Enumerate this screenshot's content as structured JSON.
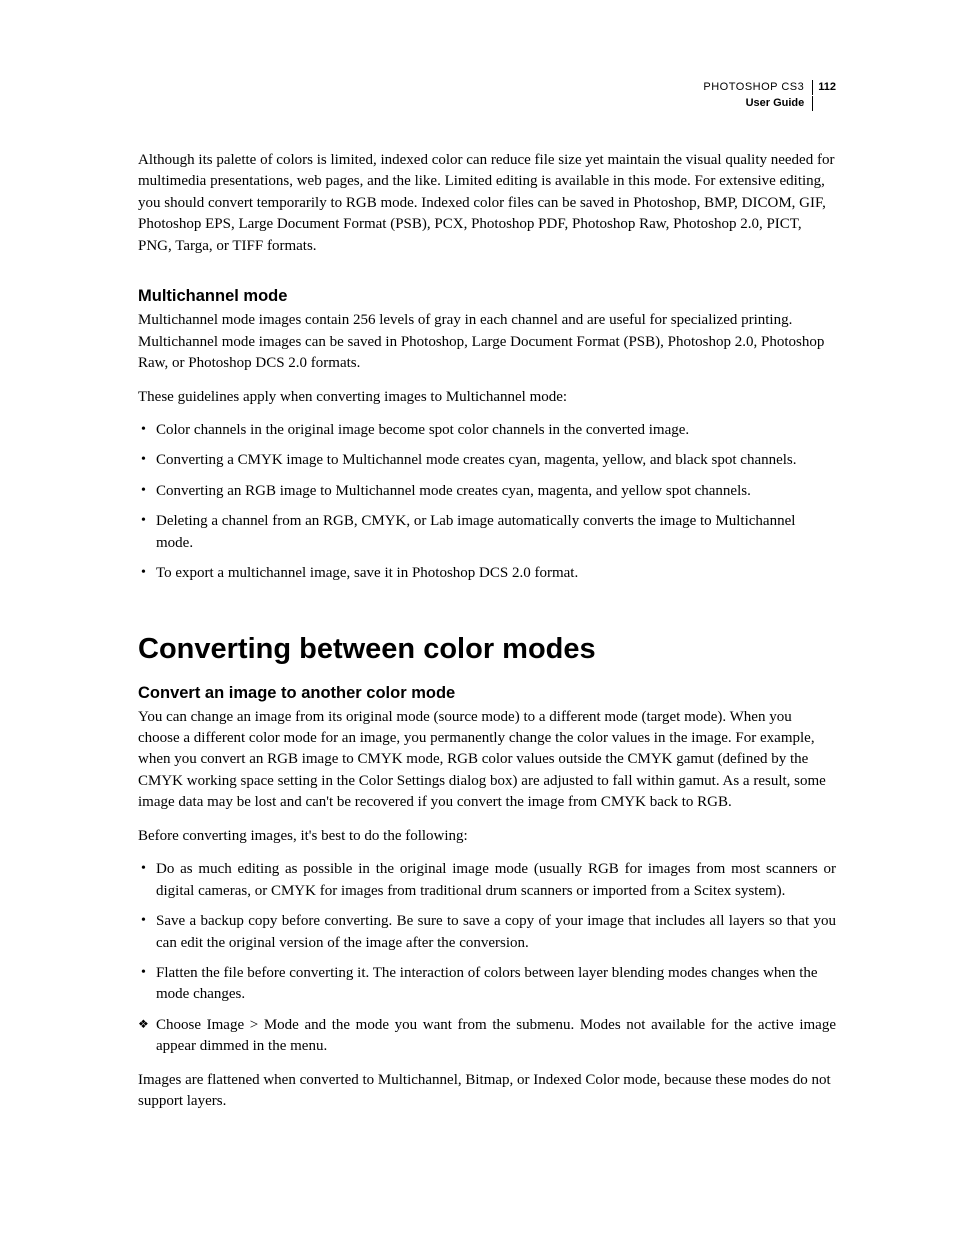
{
  "header": {
    "product": "PHOTOSHOP CS3",
    "page_number": "112",
    "guide": "User Guide"
  },
  "intro_para": "Although its palette of colors is limited, indexed color can reduce file size yet maintain the visual quality needed for multimedia presentations, web pages, and the like. Limited editing is available in this mode. For extensive editing, you should convert temporarily to RGB mode. Indexed color files can be saved in Photoshop, BMP, DICOM, GIF, Photoshop EPS, Large Document Format (PSB), PCX, Photoshop PDF, Photoshop Raw, Photoshop 2.0, PICT, PNG, Targa, or TIFF formats.",
  "multichannel": {
    "heading": "Multichannel mode",
    "para1": "Multichannel mode images contain 256 levels of gray in each channel and are useful for specialized printing. Multichannel mode images can be saved in Photoshop, Large Document Format (PSB), Photoshop 2.0, Photoshop Raw, or Photoshop DCS 2.0 formats.",
    "para2": "These guidelines apply when converting images to Multichannel mode:",
    "bullets": [
      "Color channels in the original image become spot color channels in the converted image.",
      "Converting a CMYK image to Multichannel mode creates cyan, magenta, yellow, and black spot channels.",
      "Converting an RGB image to Multichannel mode creates cyan, magenta, and yellow spot channels.",
      "Deleting a channel from an RGB, CMYK, or Lab image automatically converts the image to Multichannel mode.",
      "To export a multichannel image, save it in Photoshop DCS 2.0 format."
    ]
  },
  "converting": {
    "heading": "Converting between color modes",
    "convert_image": {
      "heading": "Convert an image to another color mode",
      "para1": "You can change an image from its original mode (source mode) to a different mode (target mode). When you choose a different color mode for an image, you permanently change the color values in the image. For example, when you convert an RGB image to CMYK mode, RGB color values outside the CMYK gamut (defined by the CMYK working space setting in the Color Settings dialog box) are adjusted to fall within gamut. As a result, some image data may be lost and can't be recovered if you convert the image from CMYK back to RGB.",
      "para2": "Before converting images, it's best to do the following:",
      "bullets": [
        "Do as much editing as possible in the original image mode (usually RGB for images from most scanners or digital cameras, or CMYK for images from traditional drum scanners or imported from a Scitex system).",
        "Save a backup copy before converting. Be sure to save a copy of your image that includes all layers so that you can edit the original version of the image after the conversion.",
        "Flatten the file before converting it. The interaction of colors between layer blending modes changes when the mode changes."
      ],
      "diamond": "Choose Image > Mode and the mode you want from the submenu. Modes not available for the active image appear dimmed in the menu.",
      "para3": "Images are flattened when converted to Multichannel, Bitmap, or Indexed Color mode, because these modes do not support layers."
    }
  }
}
